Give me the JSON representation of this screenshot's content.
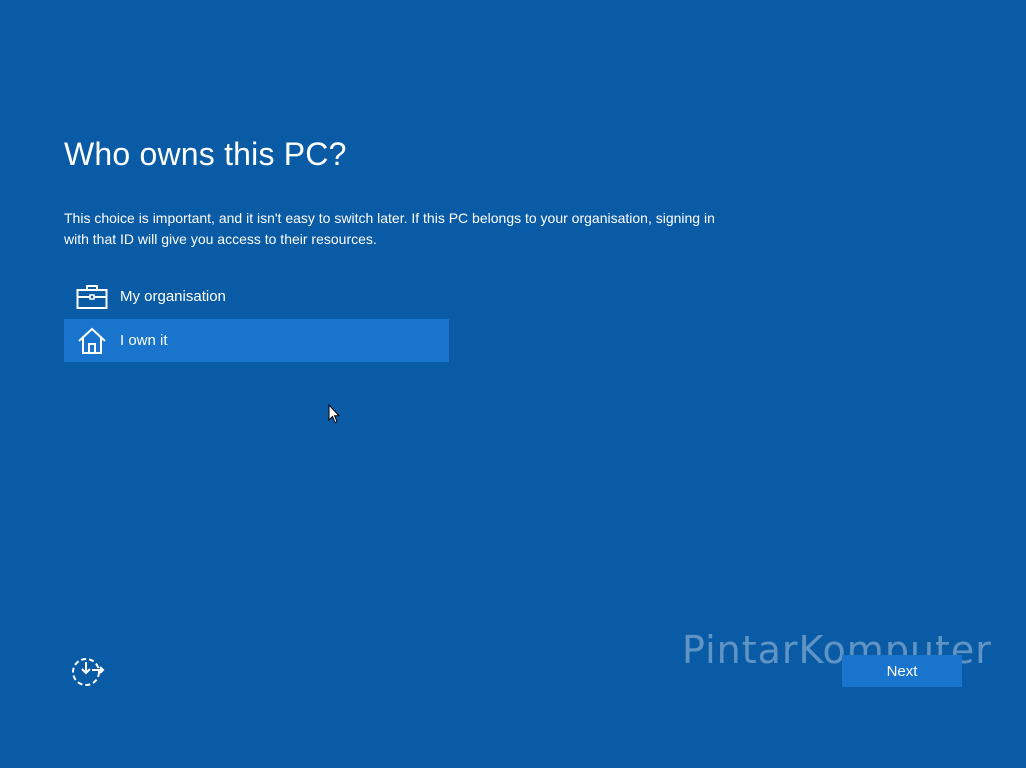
{
  "page": {
    "title": "Who owns this PC?",
    "description": "This choice is important, and it isn't easy to switch later. If this PC belongs to your organisation, signing in with that ID will give you access to their resources."
  },
  "options": [
    {
      "label": "My organisation",
      "icon": "briefcase-icon",
      "selected": false
    },
    {
      "label": "I own it",
      "icon": "home-icon",
      "selected": true
    }
  ],
  "footer": {
    "ease_of_access_icon": "ease-of-access-icon",
    "next_label": "Next"
  },
  "watermark": {
    "text": "PintarKomputer"
  },
  "colors": {
    "background": "#0a5ba6",
    "selected": "#1874cc",
    "button": "#1874cc",
    "text": "#ffffff"
  }
}
